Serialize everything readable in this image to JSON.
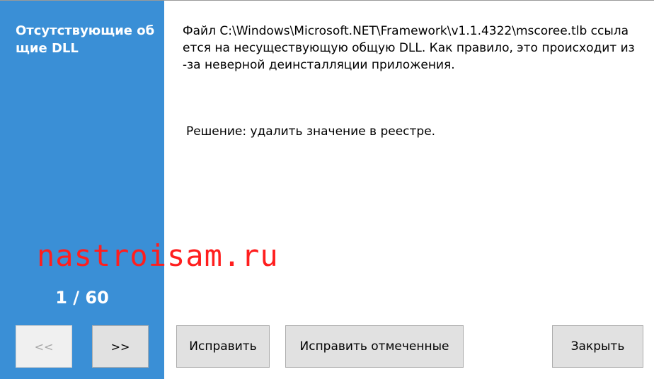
{
  "sidebar": {
    "title": "Отсутствующие общие DLL",
    "page_counter": "1 / 60",
    "prev_label": "<<",
    "next_label": ">>"
  },
  "message": {
    "text": "Файл C:\\Windows\\Microsoft.NET\\Framework\\v1.1.4322\\mscoree.tlb ссылается на несуществующую общую DLL. Как правило, это происходит из-за неверной деинсталляции приложения.",
    "solution": "Решение: удалить значение в реестре."
  },
  "watermark": "nastroisam.ru",
  "buttons": {
    "fix": "Исправить",
    "fix_checked": "Исправить отмеченные",
    "close": "Закрыть"
  },
  "colors": {
    "sidebar_bg": "#3a8fd6",
    "watermark": "#ff1e1e"
  }
}
